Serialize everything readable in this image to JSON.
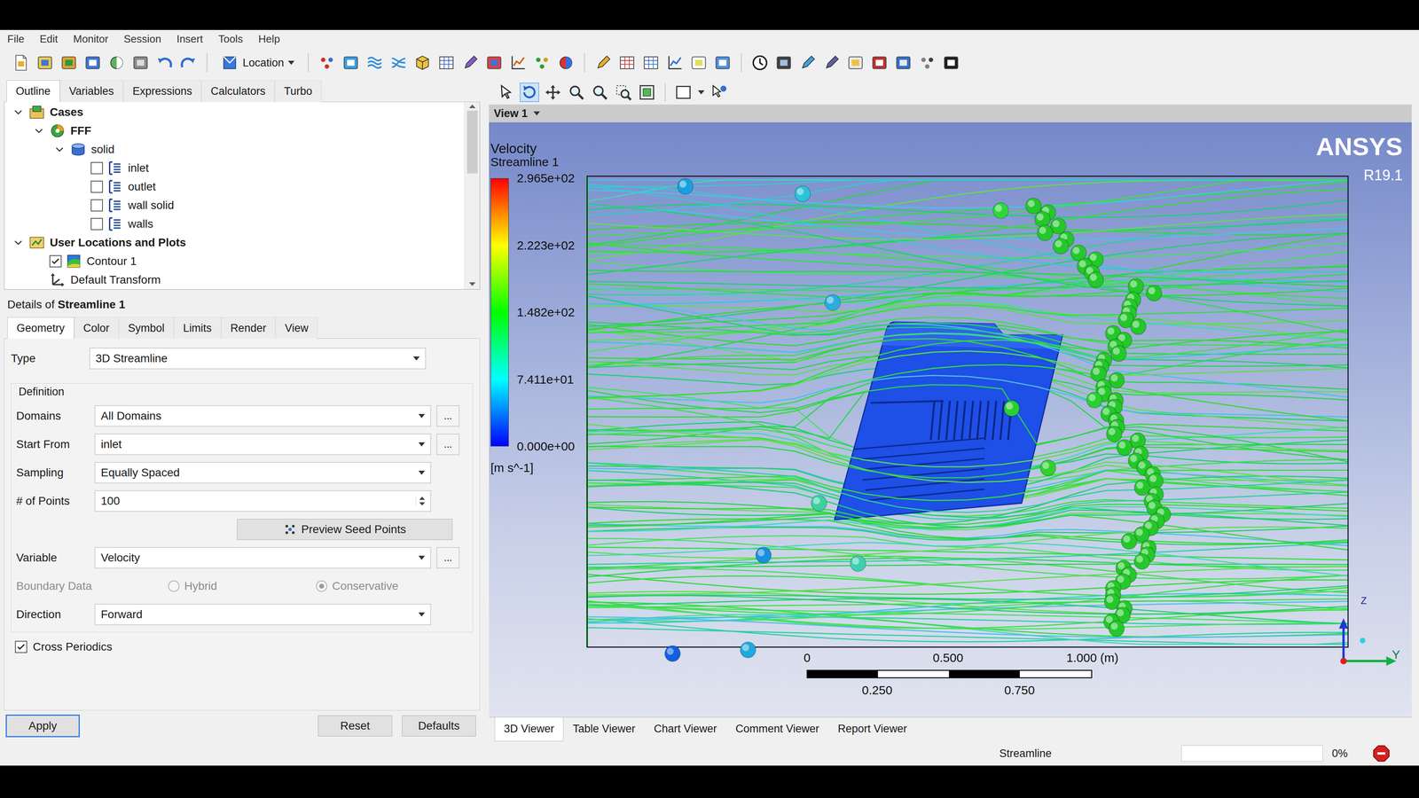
{
  "menu": [
    "File",
    "Edit",
    "Monitor",
    "Session",
    "Insert",
    "Tools",
    "Help"
  ],
  "toolbar": {
    "location": "Location"
  },
  "outline_tabs": [
    {
      "label": "Outline",
      "selected": true
    },
    {
      "label": "Variables",
      "selected": false
    },
    {
      "label": "Expressions",
      "selected": false
    },
    {
      "label": "Calculators",
      "selected": false
    },
    {
      "label": "Turbo",
      "selected": false
    }
  ],
  "tree": [
    {
      "label": "Cases",
      "depth": 0,
      "kind": "cases",
      "expanded": true
    },
    {
      "label": "FFF",
      "depth": 1,
      "kind": "case",
      "expanded": true
    },
    {
      "label": "solid",
      "depth": 2,
      "kind": "domain",
      "expanded": true
    },
    {
      "label": "inlet",
      "depth": 3,
      "kind": "boundary",
      "checked": false
    },
    {
      "label": "outlet",
      "depth": 3,
      "kind": "boundary",
      "checked": false
    },
    {
      "label": "wall solid",
      "depth": 3,
      "kind": "boundary",
      "checked": false
    },
    {
      "label": "walls",
      "depth": 3,
      "kind": "boundary",
      "checked": false
    },
    {
      "label": "User Locations and Plots",
      "depth": 0,
      "kind": "group",
      "expanded": true
    },
    {
      "label": "Contour 1",
      "depth": 1,
      "kind": "contour",
      "checked": true
    },
    {
      "label": "Default Transform",
      "depth": 1,
      "kind": "transform"
    }
  ],
  "details": {
    "prefix": "Details of ",
    "name": "Streamline 1",
    "tabs": [
      {
        "label": "Geometry",
        "selected": true
      },
      {
        "label": "Color",
        "selected": false
      },
      {
        "label": "Symbol",
        "selected": false
      },
      {
        "label": "Limits",
        "selected": false
      },
      {
        "label": "Render",
        "selected": false
      },
      {
        "label": "View",
        "selected": false
      }
    ],
    "type": {
      "label": "Type",
      "value": "3D Streamline"
    },
    "group": {
      "label": "Definition"
    },
    "fields": [
      {
        "kind": "select",
        "label": "Domains",
        "value": "All Domains",
        "more": "..."
      },
      {
        "kind": "select",
        "label": "Start From",
        "value": "inlet",
        "more": "..."
      },
      {
        "kind": "select",
        "label": "Sampling",
        "value": "Equally Spaced"
      },
      {
        "kind": "spin",
        "label": "# of Points",
        "value": "100"
      },
      {
        "kind": "button",
        "label": "Preview Seed Points"
      },
      {
        "kind": "select",
        "label": "Variable",
        "value": "Velocity",
        "more": "..."
      },
      {
        "kind": "radio",
        "label": "Boundary Data",
        "disabled": true,
        "options": [
          {
            "label": "Hybrid",
            "selected": false
          },
          {
            "label": "Conservative",
            "selected": true
          }
        ]
      },
      {
        "kind": "select",
        "label": "Direction",
        "value": "Forward"
      }
    ],
    "cross_periodics": {
      "label": "Cross Periodics",
      "checked": true
    },
    "buttons": [
      {
        "label": "Apply",
        "default": true
      },
      {
        "label": "Reset",
        "default": false
      },
      {
        "label": "Defaults",
        "default": false
      }
    ]
  },
  "view_tools": [
    {
      "selected": false
    },
    {
      "selected": true
    },
    {
      "selected": false
    },
    {
      "selected": false
    },
    {
      "selected": false
    },
    {
      "selected": false
    },
    {
      "selected": false
    },
    {
      "selected": false
    },
    {
      "selected": false
    }
  ],
  "viewer": {
    "view": "View 1",
    "legend": {
      "title": "Velocity",
      "plot": "Streamline 1",
      "ticks": [
        "2.965e+02",
        "2.223e+02",
        "1.482e+02",
        "7.411e+01",
        "0.000e+00"
      ],
      "unit": "[m s^-1]"
    },
    "logo": {
      "brand": "ANSYS",
      "version": "R19.1"
    },
    "scale": {
      "upper": [
        "0",
        "0.500",
        "1.000 (m)"
      ],
      "lower": [
        "0.250",
        "0.750"
      ]
    },
    "axes": [
      "Z",
      "Y"
    ]
  },
  "viewer_tabs": [
    {
      "label": "3D Viewer",
      "selected": true
    },
    {
      "label": "Table Viewer",
      "selected": false
    },
    {
      "label": "Chart Viewer",
      "selected": false
    },
    {
      "label": "Comment Viewer",
      "selected": false
    },
    {
      "label": "Report Viewer",
      "selected": false
    }
  ],
  "status_bar": {
    "task": "Streamline",
    "progress": "0%",
    "level": 0
  }
}
